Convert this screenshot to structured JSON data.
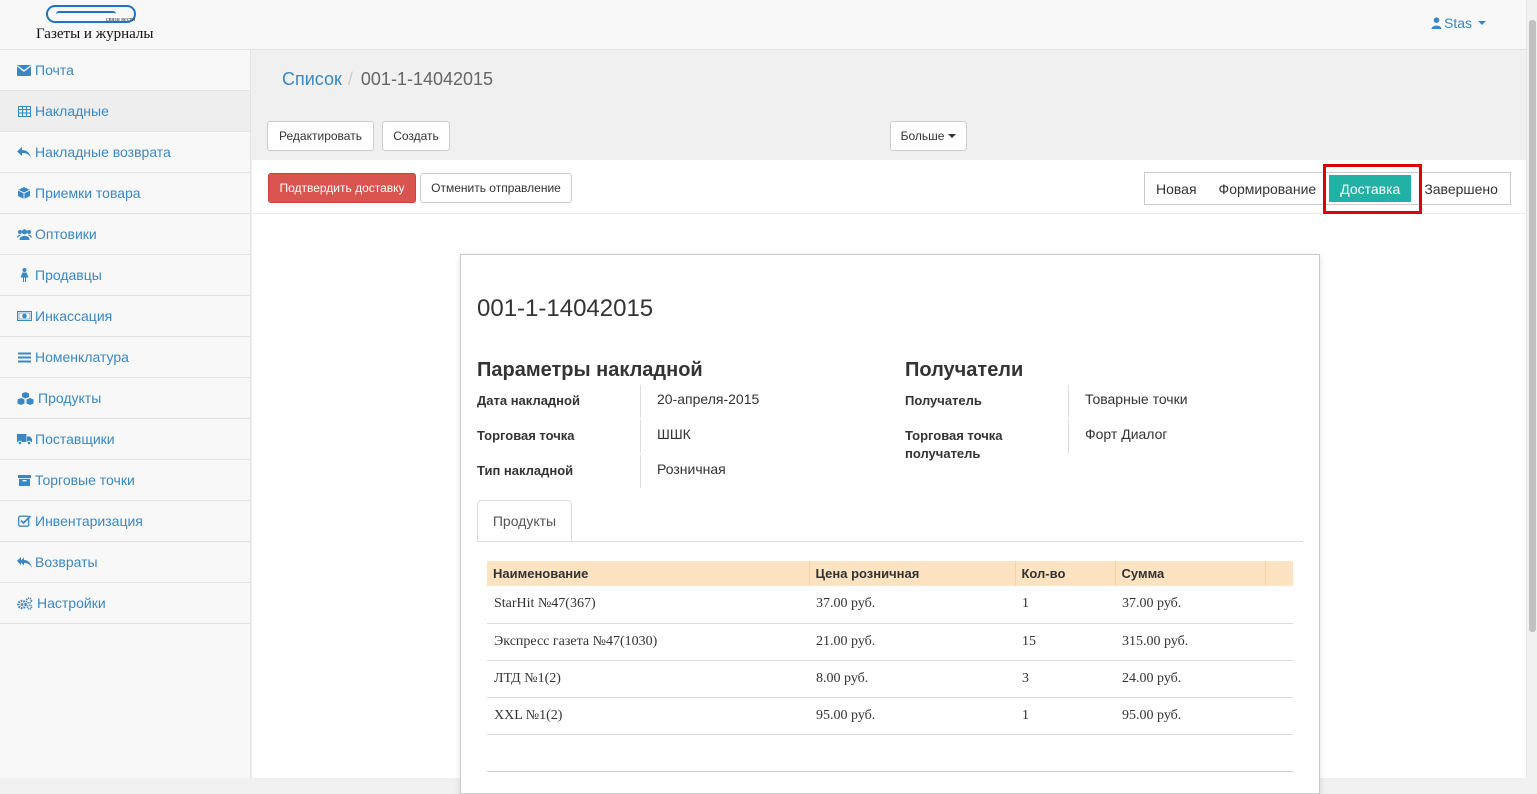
{
  "header": {
    "logo_small": "связи вести",
    "logo_text": "Газеты и журналы",
    "user": "Stas"
  },
  "sidebar": {
    "items": [
      {
        "label": "Почта",
        "icon": "envelope-icon"
      },
      {
        "label": "Накладные",
        "icon": "table-icon"
      },
      {
        "label": "Накладные возврата",
        "icon": "reply-icon"
      },
      {
        "label": "Приемки товара",
        "icon": "cube-icon"
      },
      {
        "label": "Оптовики",
        "icon": "users-icon"
      },
      {
        "label": "Продавцы",
        "icon": "female-icon"
      },
      {
        "label": "Инкассация",
        "icon": "money-icon"
      },
      {
        "label": "Номенклатура",
        "icon": "list-icon"
      },
      {
        "label": "Продукты",
        "icon": "cubes-icon"
      },
      {
        "label": "Поставщики",
        "icon": "truck-icon"
      },
      {
        "label": "Торговые точки",
        "icon": "archive-icon"
      },
      {
        "label": "Инвентаризация",
        "icon": "check-square-icon"
      },
      {
        "label": "Возвраты",
        "icon": "reply-all-icon"
      },
      {
        "label": "Настройки",
        "icon": "cogs-icon"
      }
    ],
    "active_index": 1
  },
  "breadcrumb": {
    "list": "Список",
    "sep": "/",
    "current": "001-1-14042015"
  },
  "toolbar": {
    "edit": "Редактировать",
    "create": "Создать",
    "more": "Больше"
  },
  "actions": {
    "confirm": "Подтвердить доставку",
    "cancel": "Отменить отправление"
  },
  "stages": [
    "Новая",
    "Формирование",
    "Доставка",
    "Завершено"
  ],
  "current_stage": "Доставка",
  "colors": {
    "accent": "#22b1a5",
    "danger": "#d9534f",
    "link": "#3a87c6",
    "highlight": "#e00000",
    "table_header": "#fde3c1"
  },
  "document": {
    "title": "001-1-14042015",
    "params_title": "Параметры накладной",
    "params": [
      {
        "label": "Дата накладной",
        "value": "20-апреля-2015"
      },
      {
        "label": "Торговая точка",
        "value": "ШШК"
      },
      {
        "label": "Тип накладной",
        "value": "Розничная"
      }
    ],
    "recipients_title": "Получатели",
    "recipients": [
      {
        "label": "Получатель",
        "value": "Товарные точки"
      },
      {
        "label": "Торговая точка получатель",
        "value": "Форт Диалог"
      }
    ],
    "tab": "Продукты",
    "columns": [
      "Наименование",
      "Цена розничная",
      "Кол-во",
      "Сумма"
    ],
    "rows": [
      [
        "StarHit №47(367)",
        "37.00 руб.",
        "1",
        "37.00 руб."
      ],
      [
        "Экспресс газета №47(1030)",
        "21.00 руб.",
        "15",
        "315.00 руб."
      ],
      [
        "ЛТД №1(2)",
        "8.00 руб.",
        "3",
        "24.00 руб."
      ],
      [
        "XXL №1(2)",
        "95.00 руб.",
        "1",
        "95.00 руб."
      ]
    ]
  }
}
